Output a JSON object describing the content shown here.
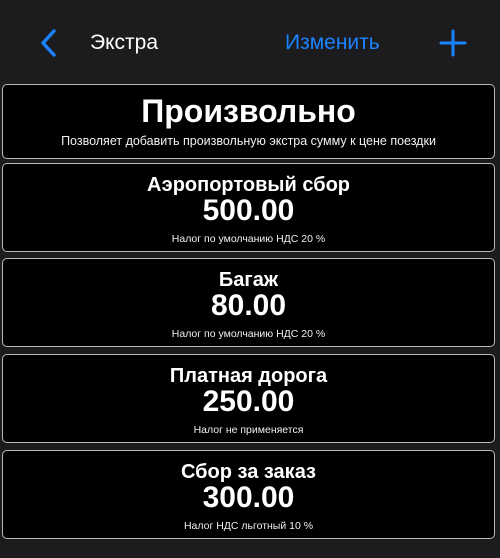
{
  "navbar": {
    "title": "Экстра",
    "edit_label": "Изменить",
    "accent_color": "#1a82ff"
  },
  "free_extra": {
    "title": "Произвольно",
    "description": "Позволяет добавить произвольную экстра сумму к цене поездки"
  },
  "extras": [
    {
      "name": "Аэропортовый сбор",
      "amount": "500.00",
      "tax": "Налог по умолчанию НДС 20 %"
    },
    {
      "name": "Багаж",
      "amount": "80.00",
      "tax": "Налог по умолчанию НДС 20 %"
    },
    {
      "name": "Платная дорога",
      "amount": "250.00",
      "tax": "Налог не применяется"
    },
    {
      "name": "Сбор за заказ",
      "amount": "300.00",
      "tax": "Налог НДС льготный 10 %"
    }
  ],
  "icons": {
    "back": "chevron-left-icon",
    "add": "plus-icon"
  }
}
